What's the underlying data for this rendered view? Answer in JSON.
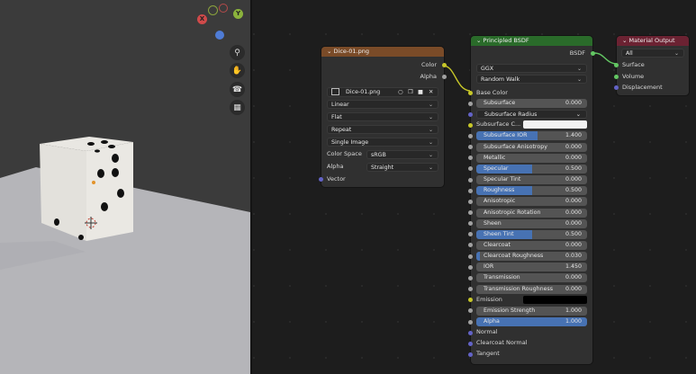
{
  "image_node": {
    "title": "Dice-01.png",
    "outputs": [
      "Color",
      "Alpha"
    ],
    "image_name": "Dice-01.png",
    "interpolation": "Linear",
    "projection": "Flat",
    "extension": "Repeat",
    "source": "Single Image",
    "color_space_label": "Color Space",
    "color_space": "sRGB",
    "alpha_label": "Alpha",
    "alpha_mode": "Straight",
    "input": "Vector"
  },
  "bsdf_node": {
    "title": "Principled BSDF",
    "output": "BSDF",
    "distribution": "GGX",
    "subsurface_method": "Random Walk",
    "base_color": "Base Color",
    "subsurface_color": "Subsurface C...",
    "emission": "Emission",
    "fields": [
      {
        "label": "Subsurface",
        "value": "0.000",
        "fill": 0
      },
      {
        "label": "Subsurface Radius",
        "value": "",
        "fill": 0
      },
      {
        "label": "Subsurface IOR",
        "value": "1.400",
        "fill": 0.55
      },
      {
        "label": "Subsurface Anisotropy",
        "value": "0.000",
        "fill": 0
      },
      {
        "label": "Metallic",
        "value": "0.000",
        "fill": 0
      },
      {
        "label": "Specular",
        "value": "0.500",
        "fill": 0.5
      },
      {
        "label": "Specular Tint",
        "value": "0.000",
        "fill": 0
      },
      {
        "label": "Roughness",
        "value": "0.500",
        "fill": 0.5
      },
      {
        "label": "Anisotropic",
        "value": "0.000",
        "fill": 0
      },
      {
        "label": "Anisotropic Rotation",
        "value": "0.000",
        "fill": 0
      },
      {
        "label": "Sheen",
        "value": "0.000",
        "fill": 0
      },
      {
        "label": "Sheen Tint",
        "value": "0.500",
        "fill": 0.5
      },
      {
        "label": "Clearcoat",
        "value": "0.000",
        "fill": 0
      },
      {
        "label": "Clearcoat Roughness",
        "value": "0.030",
        "fill": 0.03
      },
      {
        "label": "IOR",
        "value": "1.450",
        "fill": 0
      },
      {
        "label": "Transmission",
        "value": "0.000",
        "fill": 0
      },
      {
        "label": "Transmission Roughness",
        "value": "0.000",
        "fill": 0
      },
      {
        "label": "Emission Strength",
        "value": "1.000",
        "fill": 0
      },
      {
        "label": "Alpha",
        "value": "1.000",
        "fill": 1
      }
    ],
    "bottom_inputs": [
      "Normal",
      "Clearcoat Normal",
      "Tangent"
    ]
  },
  "output_node": {
    "title": "Material Output",
    "target": "All",
    "inputs": [
      "Surface",
      "Volume",
      "Displacement"
    ]
  },
  "gizmo": {
    "y_label": "Y",
    "x_label": "X"
  },
  "colors": {
    "image_header": "#7a4b28",
    "bsdf_header": "#2a6b2a",
    "output_header": "#6b2232",
    "socket_yellow": "#c7c729",
    "socket_grey": "#a1a1a1",
    "socket_purple": "#6363c7",
    "socket_green": "#63c763",
    "accent_blue": "#4772b3"
  }
}
